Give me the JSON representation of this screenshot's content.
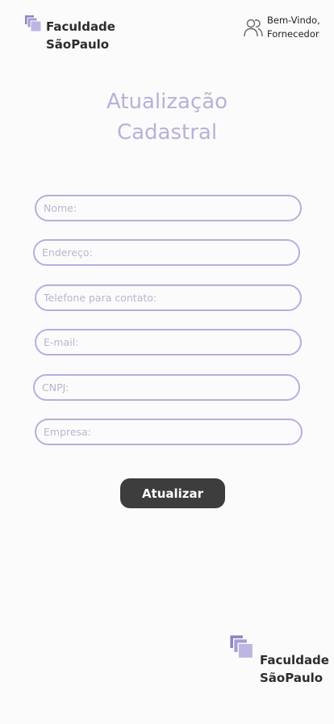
{
  "header": {
    "brand_line1": "Faculdade",
    "brand_line2": "SãoPaulo",
    "logo_icon": "stacked-squares-icon",
    "user_icon": "users-icon",
    "greeting_line1": "Bem-Vindo,",
    "greeting_line2": "Fornecedor"
  },
  "main": {
    "title_line1": "Atualização",
    "title_line2": "Cadastral"
  },
  "form": {
    "fields": [
      {
        "placeholder": "Nome:"
      },
      {
        "placeholder": "Endereço:"
      },
      {
        "placeholder": "Telefone para contato:"
      },
      {
        "placeholder": "E-mail:"
      },
      {
        "placeholder": "CNPJ:"
      },
      {
        "placeholder": "Empresa:"
      }
    ],
    "submit_label": "Atualizar"
  },
  "footer": {
    "brand_line1": "Faculdade",
    "brand_line2": "SãoPaulo",
    "logo_icon": "stacked-squares-icon"
  },
  "colors": {
    "accent": "#b6aee0",
    "title": "#b8b1d8",
    "button": "#3d3d3d",
    "background": "#fbfbfc"
  }
}
